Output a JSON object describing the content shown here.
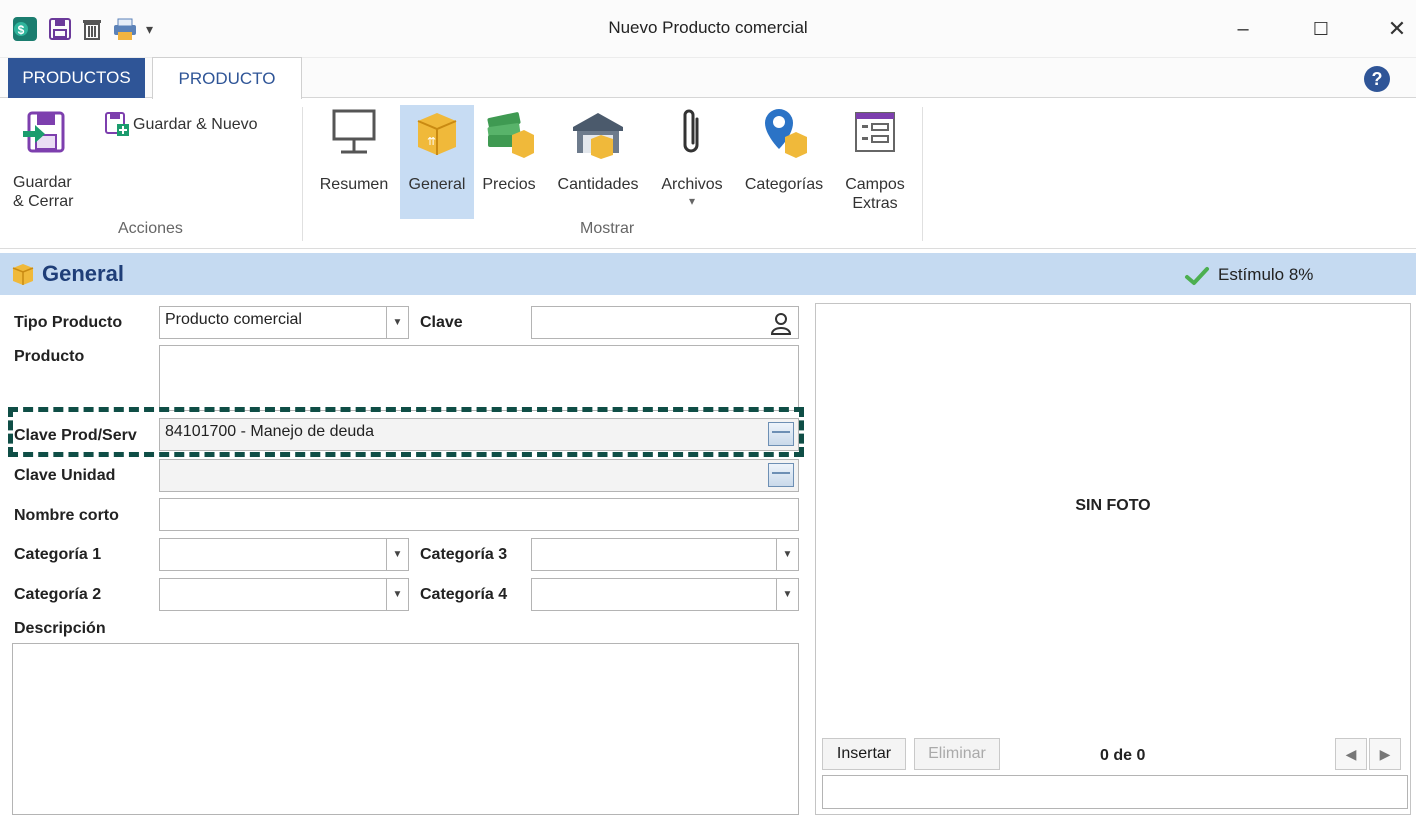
{
  "window": {
    "title": "Nuevo Producto comercial",
    "controls": {
      "minimize": "–",
      "maximize": "☐",
      "close": "✕"
    }
  },
  "tabs": [
    {
      "label": "PRODUCTOS",
      "active": false
    },
    {
      "label": "PRODUCTO",
      "active": true
    }
  ],
  "help_label": "?",
  "ribbon": {
    "acciones": {
      "group_label": "Acciones",
      "save_close_label": "Guardar & Cerrar",
      "save_new_label": "Guardar & Nuevo"
    },
    "mostrar": {
      "group_label": "Mostrar",
      "items": [
        {
          "label": "Resumen",
          "icon": "monitor-icon"
        },
        {
          "label": "General",
          "icon": "box-icon",
          "active": true
        },
        {
          "label": "Precios",
          "icon": "money-icon"
        },
        {
          "label": "Cantidades",
          "icon": "warehouse-icon"
        },
        {
          "label": "Archivos",
          "icon": "paperclip-icon",
          "dropdown": "▾"
        },
        {
          "label": "Categorías",
          "icon": "location-pin-icon"
        },
        {
          "label": "Campos Extras",
          "icon": "form-icon"
        }
      ]
    }
  },
  "section": {
    "title": "General",
    "status": "Estímulo 8%",
    "status_color": "#4caf50"
  },
  "form": {
    "tipo_producto": {
      "label": "Tipo Producto",
      "value": "Producto comercial"
    },
    "clave": {
      "label": "Clave",
      "value": ""
    },
    "producto": {
      "label": "Producto",
      "value": ""
    },
    "clave_prod_serv": {
      "label": "Clave Prod/Serv",
      "value": "84101700 - Manejo de deuda"
    },
    "clave_unidad": {
      "label": "Clave Unidad",
      "value": ""
    },
    "nombre_corto": {
      "label": "Nombre corto",
      "value": ""
    },
    "categoria1": {
      "label": "Categoría 1",
      "value": ""
    },
    "categoria2": {
      "label": "Categoría 2",
      "value": ""
    },
    "categoria3": {
      "label": "Categoría 3",
      "value": ""
    },
    "categoria4": {
      "label": "Categoría 4",
      "value": ""
    },
    "descripcion": {
      "label": "Descripción",
      "value": ""
    }
  },
  "photo": {
    "placeholder": "SIN FOTO",
    "insert_label": "Insertar",
    "delete_label": "Eliminar",
    "pager": "0 de 0",
    "prev": "◀",
    "next": "▶"
  },
  "colors": {
    "accent": "#2f5597",
    "section_bg": "#c5daf1",
    "highlight": "#0f4e46"
  }
}
